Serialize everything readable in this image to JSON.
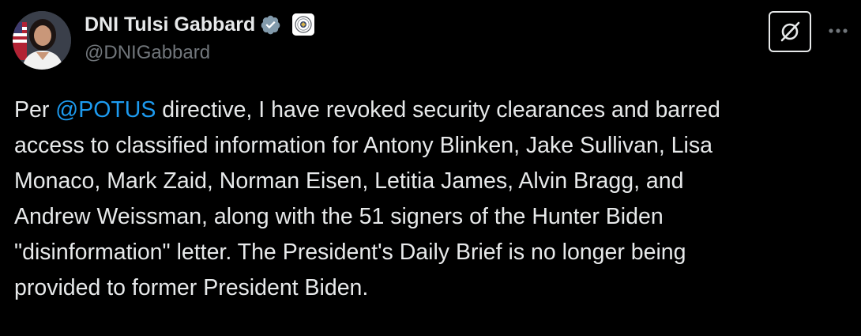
{
  "author": {
    "display_name": "DNI Tulsi Gabbard",
    "handle": "@DNIGabbard",
    "verified": true
  },
  "icons": {
    "avatar": "profile-photo",
    "verified": "verified-badge-icon",
    "affiliation": "government-seal-badge-icon",
    "grok": "grok-icon",
    "more": "more-horizontal-icon"
  },
  "colors": {
    "background": "#000000",
    "text": "#e7e9ea",
    "secondary_text": "#71767b",
    "link": "#1d9bf0",
    "verified_badge": "#829aab"
  },
  "tweet": {
    "text_before_mention": "Per ",
    "mention": "@POTUS",
    "text_after_mention": " directive, I have revoked security clearances and barred\naccess to classified information for Antony Blinken, Jake Sullivan, Lisa\nMonaco, Mark Zaid, Norman Eisen, Letitia James, Alvin Bragg, and\nAndrew Weissman, along with the 51 signers of the Hunter Biden\n\"disinformation\" letter. The President's Daily Brief is no longer being\nprovided to former President Biden."
  }
}
